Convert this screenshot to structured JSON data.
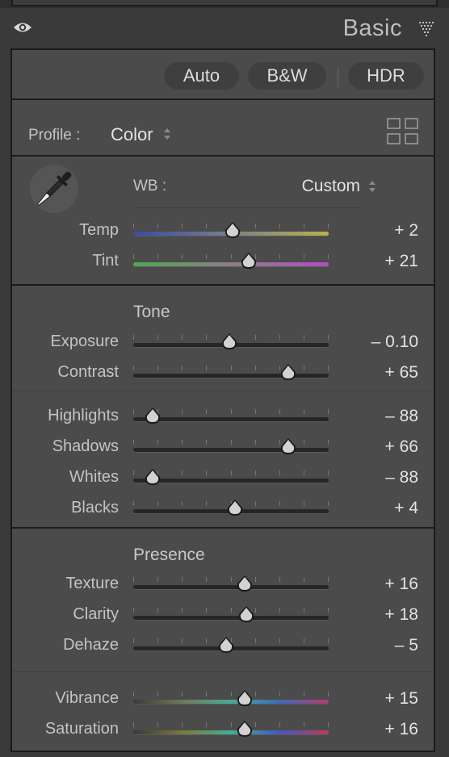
{
  "panel": {
    "title": "Basic"
  },
  "toolbar": {
    "auto_label": "Auto",
    "bw_label": "B&W",
    "hdr_label": "HDR"
  },
  "profile": {
    "label": "Profile :",
    "value": "Color"
  },
  "wb": {
    "label": "WB :",
    "value": "Custom"
  },
  "sections": {
    "tone": "Tone",
    "presence": "Presence"
  },
  "sliders": {
    "temp": {
      "label": "Temp",
      "value": "+ 2",
      "position": 0.51
    },
    "tint": {
      "label": "Tint",
      "value": "+ 21",
      "position": 0.59
    },
    "exposure": {
      "label": "Exposure",
      "value": "– 0.10",
      "position": 0.49
    },
    "contrast": {
      "label": "Contrast",
      "value": "+ 65",
      "position": 0.795
    },
    "highlights": {
      "label": "Highlights",
      "value": "– 88",
      "position": 0.1
    },
    "shadows": {
      "label": "Shadows",
      "value": "+ 66",
      "position": 0.795
    },
    "whites": {
      "label": "Whites",
      "value": "– 88",
      "position": 0.1
    },
    "blacks": {
      "label": "Blacks",
      "value": "+ 4",
      "position": 0.52
    },
    "texture": {
      "label": "Texture",
      "value": "+ 16",
      "position": 0.57
    },
    "clarity": {
      "label": "Clarity",
      "value": "+ 18",
      "position": 0.58
    },
    "dehaze": {
      "label": "Dehaze",
      "value": "– 5",
      "position": 0.475
    },
    "vibrance": {
      "label": "Vibrance",
      "value": "+ 15",
      "position": 0.57
    },
    "saturation": {
      "label": "Saturation",
      "value": "+ 16",
      "position": 0.57
    }
  }
}
